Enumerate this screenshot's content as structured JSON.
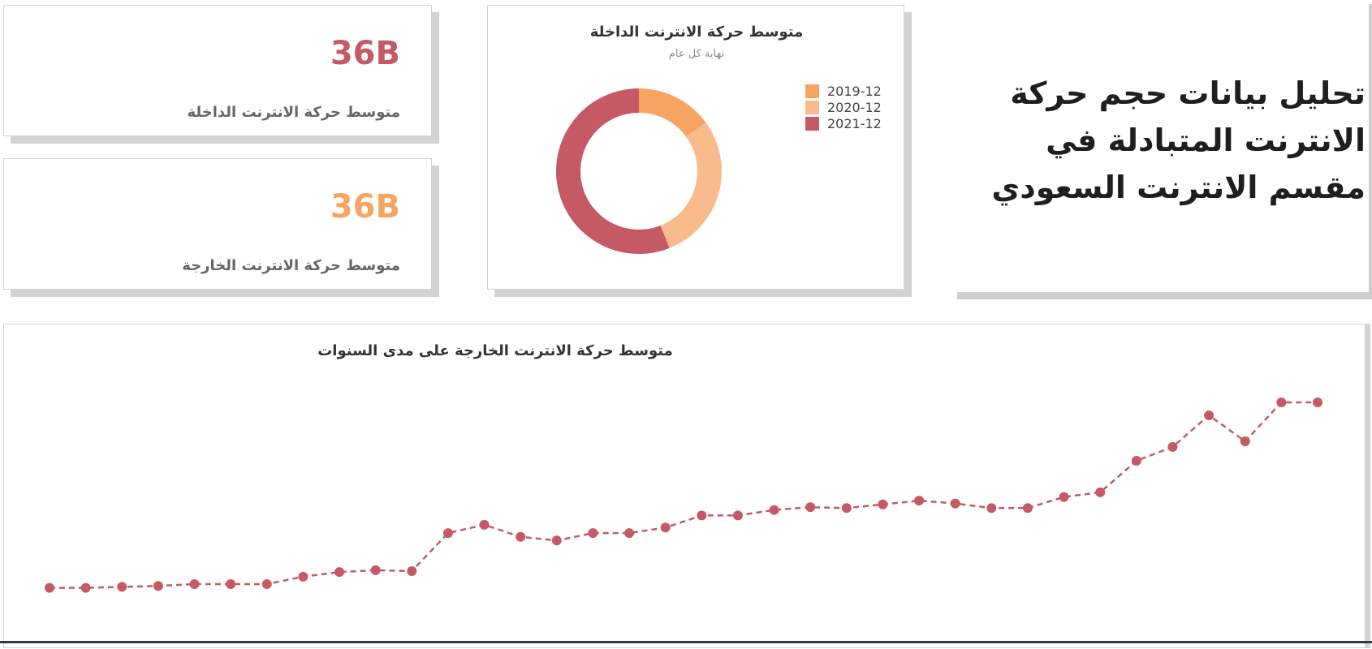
{
  "colors": {
    "red": "#c55a65",
    "orange": "#f6a462",
    "peach": "#f9bb8c"
  },
  "kpis": [
    {
      "value": "36B",
      "label": "متوسط حركة الانترنت الداخلة",
      "color": "#c55a65"
    },
    {
      "value": "36B",
      "label": "متوسط حركة الانترنت الخارجة",
      "color": "#f6a462"
    }
  ],
  "page_title": "تحليل بيانات حجم حركة الانترنت المتبادلة في مقسم الانترنت السعودي",
  "chart_data": [
    {
      "type": "pie",
      "title": "متوسط حركة الانترنت الداخلة",
      "subtitle": "نهاية كل عام",
      "categories": [
        "2019-12",
        "2020-12",
        "2021-12"
      ],
      "values": [
        15,
        29,
        56
      ],
      "colors": [
        "#f6a462",
        "#f9bb8c",
        "#c55a65"
      ],
      "legend": "right"
    },
    {
      "type": "line",
      "title": "متوسط حركة الانترنت الخارجة على مدى السنوات",
      "series": [
        {
          "values": [
            0.6,
            0.6,
            0.7,
            0.8,
            1.0,
            1.0,
            1.0,
            1.8,
            2.3,
            2.5,
            2.4,
            6.5,
            7.4,
            6.1,
            5.7,
            6.5,
            6.5,
            7.1,
            8.4,
            8.4,
            9.0,
            9.3,
            9.2,
            9.6,
            10.0,
            9.7,
            9.2,
            9.2,
            10.4,
            10.9,
            14.3,
            15.8,
            19.2,
            16.4,
            20.6,
            20.6
          ],
          "color": "#c55a65",
          "style": "dashed-markers"
        }
      ],
      "ylim": [
        -6,
        29
      ],
      "grid": false,
      "axes_visible": false
    }
  ]
}
